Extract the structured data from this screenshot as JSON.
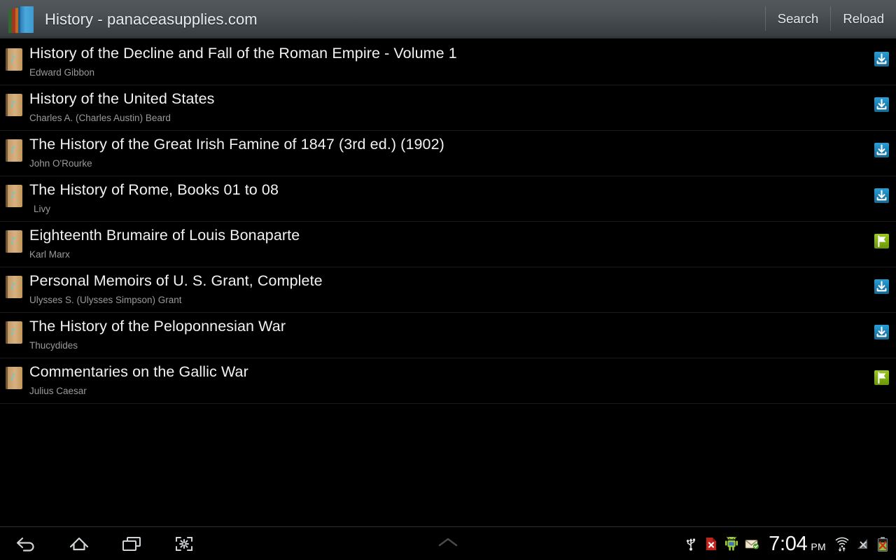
{
  "titlebar": {
    "app_icon": "books-stack-icon",
    "title": "History - panaceasupplies.com",
    "actions": [
      {
        "label": "Search",
        "name": "search-button"
      },
      {
        "label": "Reload",
        "name": "reload-button"
      }
    ]
  },
  "books": [
    {
      "title": "History of the Decline and Fall of the Roman Empire - Volume 1",
      "author": "Edward Gibbon",
      "status": "download",
      "status_icon": "download-icon",
      "indent_author": false
    },
    {
      "title": "History of the United States",
      "author": "Charles A. (Charles Austin) Beard",
      "status": "download",
      "status_icon": "download-icon",
      "indent_author": false
    },
    {
      "title": "The History of the Great Irish Famine of 1847 (3rd ed.) (1902)",
      "author": "John O'Rourke",
      "status": "download",
      "status_icon": "download-icon",
      "indent_author": false
    },
    {
      "title": "The History of Rome, Books 01 to 08",
      "author": "Livy",
      "status": "download",
      "status_icon": "download-icon",
      "indent_author": true
    },
    {
      "title": "Eighteenth Brumaire of Louis Bonaparte",
      "author": "Karl Marx",
      "status": "downloaded",
      "status_icon": "flag-icon",
      "indent_author": false
    },
    {
      "title": "Personal Memoirs of U. S. Grant, Complete",
      "author": "Ulysses S. (Ulysses Simpson) Grant",
      "status": "download",
      "status_icon": "download-icon",
      "indent_author": false
    },
    {
      "title": "The History of the Peloponnesian War",
      "author": "Thucydides",
      "status": "download",
      "status_icon": "download-icon",
      "indent_author": false
    },
    {
      "title": "Commentaries on the Gallic War",
      "author": "Julius Caesar",
      "status": "downloaded",
      "status_icon": "flag-icon",
      "indent_author": false
    }
  ],
  "navbar": {
    "buttons": [
      {
        "name": "back-button",
        "icon": "back-arrow-icon"
      },
      {
        "name": "home-button",
        "icon": "home-icon"
      },
      {
        "name": "recent-apps-button",
        "icon": "recent-apps-icon"
      },
      {
        "name": "screenshot-button",
        "icon": "screenshot-icon"
      }
    ],
    "expand_handle": {
      "name": "notifications-expand-button",
      "icon": "chevron-up-icon"
    }
  },
  "statusbar": {
    "icons": [
      {
        "name": "usb-icon"
      },
      {
        "name": "file-error-icon"
      },
      {
        "name": "android-robot-icon"
      },
      {
        "name": "email-icon"
      }
    ],
    "clock": {
      "time": "7:04",
      "period": "PM"
    },
    "right_icons": [
      {
        "name": "wifi-icon"
      },
      {
        "name": "cellular-signal-off-icon"
      },
      {
        "name": "battery-error-icon"
      }
    ]
  },
  "colors": {
    "accent_blue": "#1b7fb4",
    "accent_green": "#7fae10",
    "title_bg": "#4b5155",
    "list_bg": "#000000",
    "title_text": "#f2f2f2",
    "author_text": "#9a9a9a"
  }
}
